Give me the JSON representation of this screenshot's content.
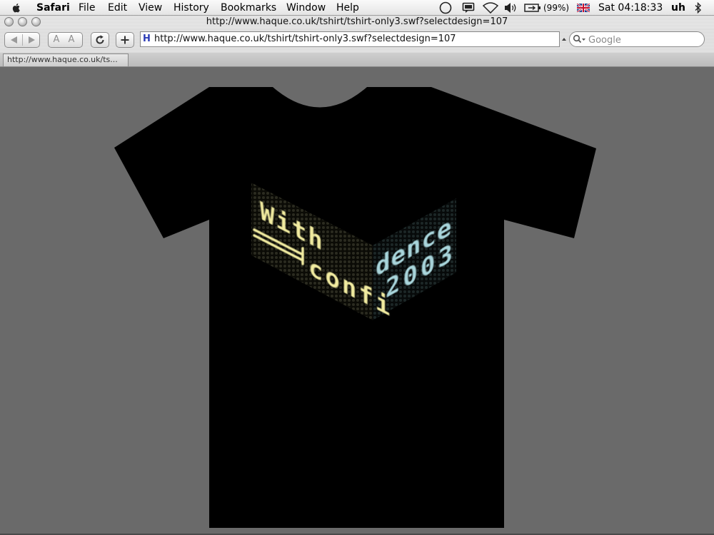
{
  "menubar": {
    "app_name": "Safari",
    "menus": [
      "File",
      "Edit",
      "View",
      "History",
      "Bookmarks",
      "Window",
      "Help"
    ],
    "battery": "(99%)",
    "clock": "Sat 04:18:33",
    "user": "uh"
  },
  "window": {
    "title": "http://www.haque.co.uk/tshirt/tshirt-only3.swf?selectdesign=107"
  },
  "toolbar": {
    "text_size_label": "A A",
    "address_value": "http://www.haque.co.uk/tshirt/tshirt-only3.swf?selectdesign=107",
    "favicon_letter": "H",
    "search_placeholder": "Google"
  },
  "tabs": [
    {
      "label": "http://www.haque.co.uk/ts..."
    }
  ],
  "content": {
    "shirt_color": "#000000",
    "design_lines": [
      {
        "text": "With",
        "color": "#f2eca0"
      },
      {
        "text": "confi",
        "color": "#f2eca0"
      },
      {
        "text": "dence",
        "color": "#a9d6dc"
      },
      {
        "text": "2003",
        "color": "#a9d6dc"
      }
    ]
  }
}
